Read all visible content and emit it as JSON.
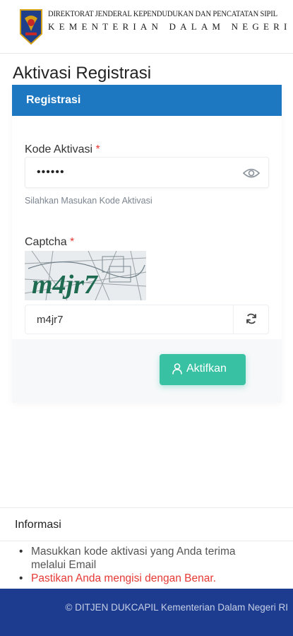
{
  "header": {
    "agency_line1": "DIREKTORAT JENDERAL KEPENDUDUKAN DAN PENCATATAN SIPIL",
    "agency_line2": "KEMENTERIAN DALAM NEGERI",
    "logo_icon": "garuda-emblem-icon"
  },
  "page_title": "Aktivasi Registrasi",
  "card": {
    "header": "Registrasi",
    "activation": {
      "label": "Kode Aktivasi",
      "required_mark": "*",
      "value": "••••••",
      "toggle_icon": "eye-icon",
      "help": "Silahkan Masukan Kode Aktivasi"
    },
    "captcha": {
      "label": "Captcha",
      "required_mark": "*",
      "image_text": "m4jr7",
      "value": "m4jr7",
      "refresh_icon": "refresh-icon"
    },
    "submit": {
      "label": "Aktifkan",
      "icon": "user-icon"
    }
  },
  "info": {
    "title": "Informasi",
    "items": [
      {
        "text": "Masukkan kode aktivasi yang Anda terima melalui Email",
        "style": "normal"
      },
      {
        "text": "Pastikan Anda mengisi dengan Benar.",
        "style": "warning"
      }
    ]
  },
  "footer": {
    "text": "© DITJEN DUKCAPIL Kementerian Dalam Negeri RI"
  },
  "colors": {
    "primary": "#1d78c1",
    "success": "#38c2a3",
    "danger": "#e53935",
    "footer_bg": "#1d3c8f"
  }
}
